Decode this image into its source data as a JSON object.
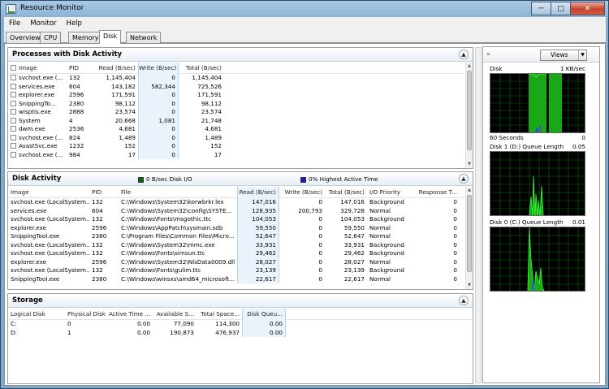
{
  "window": {
    "title": "Resource Monitor",
    "min": "─",
    "max": "□",
    "close": "✕"
  },
  "menu": [
    "File",
    "Monitor",
    "Help"
  ],
  "tabs": [
    "Overview",
    "CPU",
    "Memory",
    "Disk",
    "Network"
  ],
  "processes": {
    "title": "Processes with Disk Activity",
    "columns": [
      "Image",
      "PID",
      "Read (B/sec)",
      "Write (B/sec)",
      "Total (B/sec)"
    ],
    "rows": [
      [
        "svchost.exe (...",
        "132",
        "1,145,404",
        "0",
        "1,145,404"
      ],
      [
        "services.exe",
        "604",
        "143,182",
        "582,344",
        "725,526"
      ],
      [
        "explorer.exe",
        "2596",
        "171,591",
        "0",
        "171,591"
      ],
      [
        "SnippingTo...",
        "2380",
        "98,112",
        "0",
        "98,112"
      ],
      [
        "wisptis.exe",
        "2888",
        "23,574",
        "0",
        "23,574"
      ],
      [
        "System",
        "4",
        "20,668",
        "1,081",
        "21,748"
      ],
      [
        "dwm.exe",
        "2536",
        "4,681",
        "0",
        "4,681"
      ],
      [
        "svchost.exe (...",
        "824",
        "1,489",
        "0",
        "1,489"
      ],
      [
        "AvastSvc.exe",
        "1232",
        "152",
        "0",
        "152"
      ],
      [
        "svchost.exe (...",
        "984",
        "17",
        "0",
        "17"
      ]
    ]
  },
  "disk_activity": {
    "title": "Disk Activity",
    "legend1": "0 B/sec Disk I/O",
    "legend2": "0% Highest Active Time",
    "legend1_color": "#1a5e1a",
    "legend2_color": "#1a1ab8",
    "columns": [
      "Image",
      "PID",
      "File",
      "Read (B/sec)",
      "Write (B/sec)",
      "Total (B/sec)",
      "I/O Priority",
      "Response T..."
    ],
    "rows": [
      [
        "svchost.exe (LocalSystem...",
        "132",
        "C:\\Windows\\System32\\korwbrkr.lex",
        "147,016",
        "0",
        "147,016",
        "Background",
        "0"
      ],
      [
        "services.exe",
        "604",
        "C:\\Windows\\System32\\config\\SYSTE...",
        "128,935",
        "200,793",
        "329,728",
        "Normal",
        "0"
      ],
      [
        "svchost.exe (LocalSystem...",
        "132",
        "C:\\Windows\\Fonts\\msgothic.ttc",
        "104,053",
        "0",
        "104,053",
        "Background",
        "0"
      ],
      [
        "explorer.exe",
        "2596",
        "C:\\Windows\\AppPatch\\sysmain.sdb",
        "59,550",
        "0",
        "59,550",
        "Normal",
        "0"
      ],
      [
        "SnippingTool.exe",
        "2380",
        "C:\\Program Files\\Common Files\\Micro...",
        "52,647",
        "0",
        "52,647",
        "Normal",
        "0"
      ],
      [
        "svchost.exe (LocalSystem...",
        "132",
        "C:\\Windows\\System32\\mmc.exe",
        "33,931",
        "0",
        "33,931",
        "Background",
        "0"
      ],
      [
        "svchost.exe (LocalSystem...",
        "132",
        "C:\\Windows\\Fonts\\simsun.ttc",
        "29,462",
        "0",
        "29,462",
        "Background",
        "0"
      ],
      [
        "explorer.exe",
        "2596",
        "C:\\Windows\\System32\\NlsData0009.dll",
        "28,027",
        "0",
        "28,027",
        "Normal",
        "0"
      ],
      [
        "svchost.exe (LocalSystem...",
        "132",
        "C:\\Windows\\Fonts\\gulim.ttc",
        "23,139",
        "0",
        "23,139",
        "Background",
        "0"
      ],
      [
        "SnippingTool.exe",
        "2380",
        "C:\\Windows\\winsxs\\amd64_microsoft...",
        "22,617",
        "0",
        "22,617",
        "Normal",
        "0"
      ]
    ]
  },
  "storage": {
    "title": "Storage",
    "columns": [
      "Logical Disk",
      "Physical Disk",
      "Active Time ...",
      "Available S...",
      "Total Space...",
      "Disk Queu..."
    ],
    "rows": [
      [
        "C:",
        "0",
        "0.00",
        "77,090",
        "114,300",
        "0.00"
      ],
      [
        "D:",
        "1",
        "0.00",
        "190,873",
        "476,937",
        "0.00"
      ]
    ]
  },
  "right": {
    "views": "Views",
    "graphs": [
      {
        "title": "Disk",
        "scale": "1 KB/sec",
        "footer_left": "60 Seconds",
        "footer_right": "0"
      },
      {
        "title": "Disk 1 (D:) Queue Length",
        "scale": "0.05",
        "footer_left": "",
        "footer_right": ""
      },
      {
        "title": "Disk 0 (C:) Queue Length",
        "scale": "0.01",
        "footer_left": "",
        "footer_right": ""
      }
    ]
  },
  "icons": {
    "collapse": "chevron-up-icon",
    "nav": "double-chevron-right-icon"
  }
}
